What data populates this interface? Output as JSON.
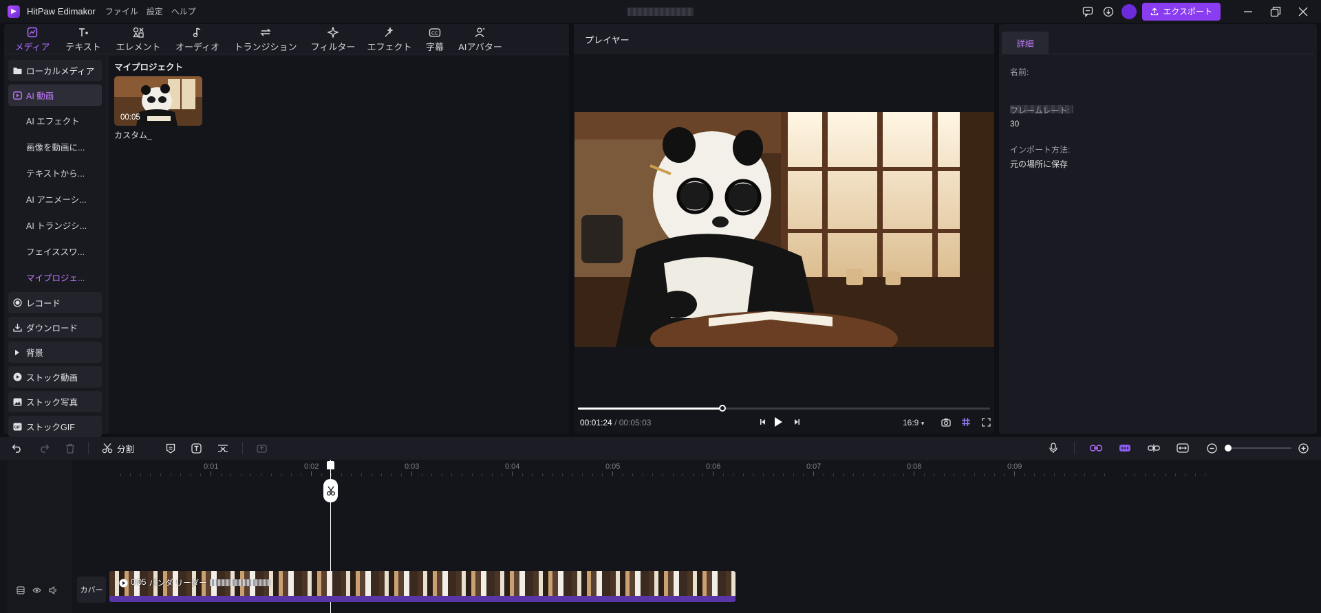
{
  "app": {
    "name": "HitPaw Edimakor",
    "menus": [
      "ファイル",
      "設定",
      "ヘルプ"
    ],
    "export_label": "エクスポート"
  },
  "toolbar_tabs": [
    {
      "label": "メディア",
      "icon": "media-icon",
      "active": true
    },
    {
      "label": "テキスト",
      "icon": "text-icon"
    },
    {
      "label": "エレメント",
      "icon": "element-icon"
    },
    {
      "label": "オーディオ",
      "icon": "audio-icon"
    },
    {
      "label": "トランジション",
      "icon": "transition-icon"
    },
    {
      "label": "フィルター",
      "icon": "filter-icon"
    },
    {
      "label": "エフェクト",
      "icon": "effect-icon"
    },
    {
      "label": "字幕",
      "icon": "subtitle-icon"
    },
    {
      "label": "AIアバター",
      "icon": "avatar-icon"
    }
  ],
  "sidebar": {
    "items": [
      {
        "label": "ローカルメディア",
        "icon": "folder-icon"
      },
      {
        "label": "AI 動画",
        "icon": "ai-video-icon",
        "active": true
      },
      {
        "label": "AI エフェクト",
        "sub": true
      },
      {
        "label": "画像を動画に...",
        "sub": true
      },
      {
        "label": "テキストから...",
        "sub": true
      },
      {
        "label": "AI アニメーシ...",
        "sub": true
      },
      {
        "label": "AI トランジシ...",
        "sub": true
      },
      {
        "label": "フェイススワ...",
        "sub": true
      },
      {
        "label": "マイプロジェ...",
        "sub": true,
        "active": true
      },
      {
        "label": "レコード",
        "icon": "record-icon"
      },
      {
        "label": "ダウンロード",
        "icon": "download-icon"
      },
      {
        "label": "背景",
        "icon": "background-icon"
      },
      {
        "label": "ストック動画",
        "icon": "stock-video-icon"
      },
      {
        "label": "ストック写真",
        "icon": "stock-photo-icon"
      },
      {
        "label": "ストックGIF",
        "icon": "stock-gif-icon"
      }
    ]
  },
  "media": {
    "section_title": "マイプロジェクト",
    "items": [
      {
        "duration": "00:05",
        "label": "カスタム_"
      }
    ]
  },
  "player": {
    "title": "プレイヤー",
    "current_time": "00:01:24",
    "separator": "/",
    "total_time": "00:05:03",
    "progress": 0.35,
    "aspect": "16:9"
  },
  "details": {
    "tab_label": "詳細",
    "name_label": "名前:",
    "framerate_label": "フレームレート:",
    "framerate_value": "30",
    "import_label": "インポート方法:",
    "import_value": "元の場所に保存"
  },
  "timeline_toolbar": {
    "split_label": "分割"
  },
  "timeline": {
    "ticks": [
      "0:01",
      "0:02",
      "0:03",
      "0:04",
      "0:05",
      "0:06",
      "0:07",
      "0:08",
      "0:09"
    ],
    "clip_duration": "0:05",
    "clip_title": "パンダ リーダー",
    "cover_label": "カバー"
  },
  "colors": {
    "accent": "#8a3cf0",
    "accent_text": "#c27bff",
    "audio_bar": "#5a35a6"
  }
}
